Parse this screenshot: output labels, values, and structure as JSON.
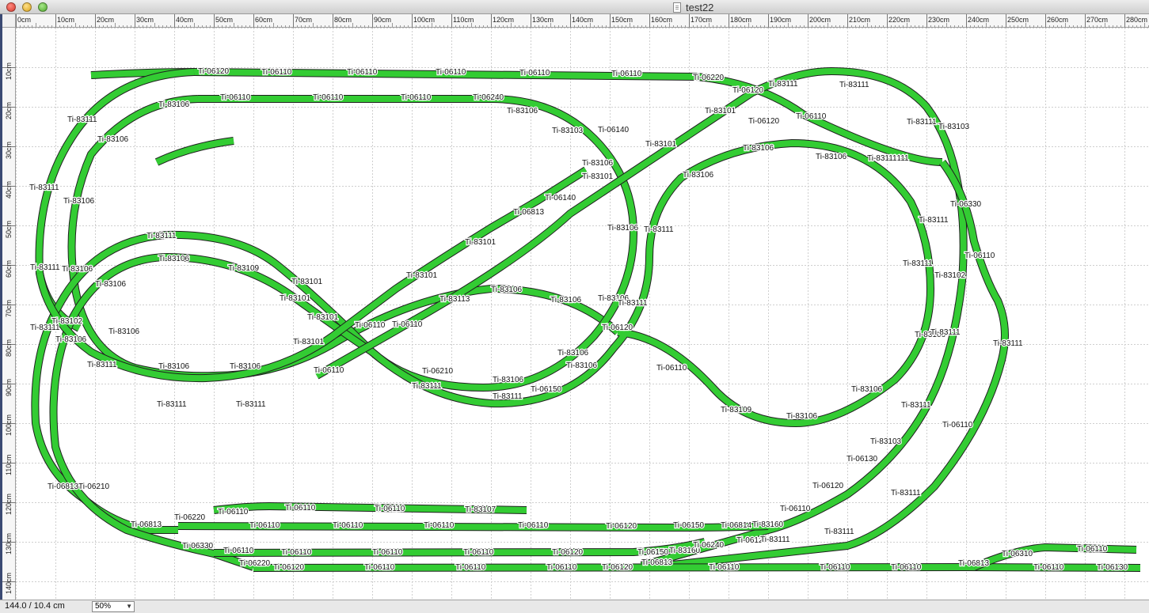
{
  "window": {
    "title": "test22",
    "buttons": [
      "close",
      "minimize",
      "zoom"
    ]
  },
  "rulers": {
    "unit": "cm",
    "x_labels": [
      "0cm",
      "10cm",
      "20cm",
      "30cm",
      "40cm",
      "50cm",
      "60cm",
      "70cm",
      "80cm",
      "90cm",
      "100cm",
      "110cm",
      "120cm",
      "130cm",
      "140cm",
      "150cm",
      "160cm",
      "170cm",
      "180cm",
      "190cm",
      "200cm",
      "210cm",
      "220cm",
      "230cm",
      "240cm",
      "250cm",
      "260cm",
      "270cm",
      "280cm"
    ],
    "y_labels": [
      "10cm",
      "20cm",
      "30cm",
      "40cm",
      "50cm",
      "60cm",
      "70cm",
      "80cm",
      "90cm",
      "100cm",
      "110cm",
      "120cm",
      "130cm",
      "140cm"
    ]
  },
  "colors": {
    "track_fill": "#33cc33",
    "track_edge": "#1f1f1f",
    "grid": "#cfcfcf",
    "title_strip": "#3b4a73"
  },
  "track_labels": [
    "Ti-06120",
    "Ti-06110",
    "Ti-06110",
    "Ti-06110",
    "Ti-06110",
    "Ti-06110",
    "Ti-06220",
    "Ti-83111",
    "Ti-06120",
    "Ti-83111",
    "Ti-83106",
    "Ti-06110",
    "Ti-06110",
    "Ti-06110",
    "Ti-06240",
    "Ti-83106",
    "Ti-83103",
    "Ti-06140",
    "Ti-83101",
    "Ti-06110",
    "Ti-83111",
    "Ti-83103",
    "Ti-83111",
    "Ti-83106",
    "Ti-83111",
    "Ti-83101",
    "Ti-83106",
    "Ti-06120",
    "Ti-06330",
    "Ti-83111",
    "Ti-83106",
    "Ti-83106",
    "Ti-83101",
    "Ti-83106",
    "Ti-83111",
    "Ti-06140",
    "Ti-06813",
    "Ti-83106",
    "Ti-83106",
    "Ti-83111",
    "Ti-06110",
    "Ti-83101",
    "Ti-83111",
    "Ti-83111",
    "Ti-83111",
    "Ti-83106",
    "Ti-83106",
    "Ti-83106",
    "Ti-83102",
    "Ti-83111",
    "Ti-83101",
    "Ti-83109",
    "Ti-83106",
    "Ti-83101",
    "Ti-83101",
    "Ti-83101",
    "Ti-83113",
    "Ti-83106",
    "Ti-83106",
    "Ti-83106",
    "Ti-83111",
    "Ti-83111",
    "Ti-83102",
    "Ti-83106",
    "Ti-06110",
    "Ti-06110",
    "Ti-06120",
    "Ti-83111",
    "Ti-83106",
    "Ti-83101",
    "Ti-06110",
    "Ti-83106",
    "Ti-83106",
    "Ti-83111",
    "Ti-06110",
    "Ti-83111",
    "Ti-06210",
    "Ti-83106",
    "Ti-83106",
    "Ti-83106",
    "Ti-83111",
    "Ti-83106",
    "Ti-83111",
    "Ti-06150",
    "Ti-83111",
    "Ti-83111",
    "Ti-83109",
    "Ti-83106",
    "Ti-83111",
    "Ti-06110",
    "Ti-83103",
    "Ti-06130",
    "Ti-06120",
    "Ti-83111",
    "Ti-83111",
    "Ti-06210",
    "Ti-06813",
    "Ti-06813",
    "Ti-06220",
    "Ti-06110",
    "Ti-06110",
    "Ti-06110",
    "Ti-83107",
    "Ti-06110",
    "Ti-06110",
    "Ti-06110",
    "Ti-06110",
    "Ti-06110",
    "Ti-06120",
    "Ti-06150",
    "Ti-06814",
    "Ti-83160",
    "Ti-06330",
    "Ti-06110",
    "Ti-06110",
    "Ti-06110",
    "Ti-06110",
    "Ti-06120",
    "Ti-06150",
    "Ti-83160",
    "Ti-06240",
    "Ti-06120",
    "Ti-83111",
    "Ti-06220",
    "Ti-06120",
    "Ti-06110",
    "Ti-06110",
    "Ti-06110",
    "Ti-06120",
    "Ti-06813",
    "Ti-06110",
    "Ti-06110",
    "Ti-06110",
    "Ti-06813",
    "Ti-06310",
    "Ti-06110",
    "Ti-06110",
    "Ti-06130"
  ],
  "status": {
    "coordinates": "144.0 /  10.4 cm",
    "zoom": "50%"
  }
}
